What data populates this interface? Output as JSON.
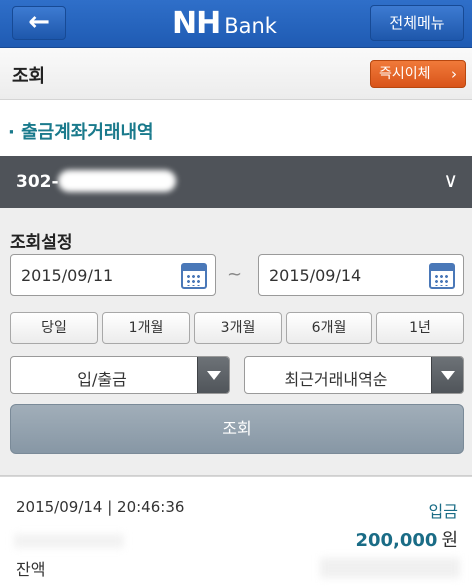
{
  "header": {
    "back_symbol": "←",
    "logo_main": "NH",
    "logo_sub": "Bank",
    "menu_label": "전체메뉴"
  },
  "title_row": {
    "title": "조회",
    "transfer_label": "즉시이체",
    "transfer_chevron": "›"
  },
  "section_title": "· 출금계좌거래내역",
  "account": {
    "number_visible": "302-",
    "chevron": "∨"
  },
  "settings": {
    "label": "조회설정",
    "start_date": "2015/09/11",
    "end_date": "2015/09/14",
    "range_separator": "~",
    "periods": [
      "당일",
      "1개월",
      "3개월",
      "6개월",
      "1년"
    ],
    "type_select": "입/출금",
    "order_select": "최근거래내역순",
    "search_label": "조회"
  },
  "transaction": {
    "datetime": "2015/09/14 | 20:46:36",
    "type": "입금",
    "amount": "200,000",
    "unit": "원",
    "balance_label": "잔액"
  },
  "colors": {
    "header_blue": "#2563bd",
    "transfer_orange": "#e86428",
    "section_teal": "#1a7a8c",
    "account_bar": "#4f5359",
    "search_button": "#94a3b0"
  }
}
